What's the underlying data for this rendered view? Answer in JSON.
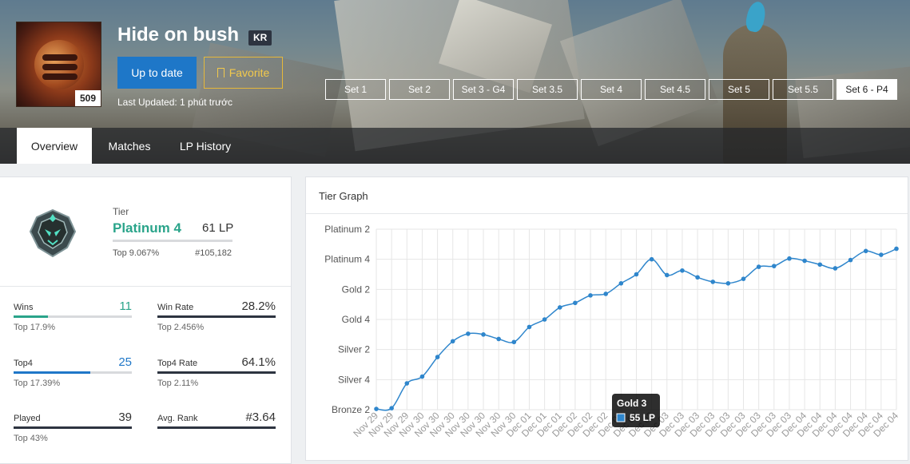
{
  "profile": {
    "summoner_name": "Hide on bush",
    "region": "KR",
    "level": "509",
    "update_button": "Up to date",
    "favorite_button": "Favorite",
    "last_updated": "Last Updated: 1 phút trước"
  },
  "set_tabs": [
    "Set 1",
    "Set 2",
    "Set 3 - G4",
    "Set 3.5",
    "Set 4",
    "Set 4.5",
    "Set 5",
    "Set 5.5",
    "Set 6 - P4"
  ],
  "active_set_tab": "Set 6 - P4",
  "nav_tabs": [
    "Overview",
    "Matches",
    "LP History"
  ],
  "active_nav_tab": "Overview",
  "tier": {
    "label": "Tier",
    "name": "Platinum 4",
    "lp": "61 LP",
    "top": "Top 9.067%",
    "rank": "#105,182",
    "emblem_icon": "platinum-emblem-icon"
  },
  "stats": {
    "wins": {
      "label": "Wins",
      "value": "11",
      "sub": "Top 17.9%",
      "fill": 0.29
    },
    "win_rate": {
      "label": "Win Rate",
      "value": "28.2%",
      "sub": "Top 2.456%",
      "fill": 1.0
    },
    "top4": {
      "label": "Top4",
      "value": "25",
      "sub": "Top 17.39%",
      "fill": 0.65
    },
    "top4_rate": {
      "label": "Top4 Rate",
      "value": "64.1%",
      "sub": "Top 2.11%",
      "fill": 1.0
    },
    "played": {
      "label": "Played",
      "value": "39",
      "sub": "Top 43%",
      "fill": 1.0
    },
    "avg_rank": {
      "label": "Avg. Rank",
      "value": "#3.64",
      "sub": "",
      "fill": 1.0
    }
  },
  "colors": {
    "teal": "#2aa48a",
    "blue": "#1f77c8",
    "dark": "#2d3440",
    "line": "#2f86cc",
    "gold": "#e6b83a"
  },
  "graph": {
    "title": "Tier Graph",
    "tooltip_title": "Gold 3",
    "tooltip_value": "55 LP"
  },
  "chart_data": {
    "type": "line",
    "title": "Tier Graph",
    "y_tick_labels": [
      "Platinum 2",
      "Platinum 4",
      "Gold 2",
      "Gold 4",
      "Silver 2",
      "Silver 4",
      "Bronze 2"
    ],
    "y_tick_values": [
      1200,
      1000,
      800,
      600,
      400,
      200,
      0
    ],
    "ylim": [
      0,
      1200
    ],
    "x": [
      "Nov 29",
      "Nov 29",
      "Nov 29",
      "Nov 30",
      "Nov 30",
      "Nov 30",
      "Nov 30",
      "Nov 30",
      "Nov 30",
      "Nov 30",
      "Dec 01",
      "Dec 01",
      "Dec 01",
      "Dec 02",
      "Dec 02",
      "Dec 02",
      "Dec 02",
      "Dec 02",
      "Dec 02",
      "Dec 03",
      "Dec 03",
      "Dec 03",
      "Dec 03",
      "Dec 03",
      "Dec 03",
      "Dec 03",
      "Dec 03",
      "Dec 03",
      "Dec 04",
      "Dec 04",
      "Dec 04",
      "Dec 04",
      "Dec 04",
      "Dec 04",
      "Dec 04"
    ],
    "values": [
      5,
      10,
      175,
      220,
      350,
      455,
      505,
      500,
      470,
      450,
      550,
      600,
      680,
      710,
      760,
      770,
      840,
      900,
      1000,
      895,
      925,
      880,
      850,
      840,
      870,
      950,
      955,
      1005,
      990,
      965,
      940,
      995,
      1055,
      1030,
      1070
    ],
    "tooltip": {
      "title": "Gold 3",
      "value": "55 LP",
      "x_index": 17
    },
    "grid": true,
    "legend": "none"
  }
}
